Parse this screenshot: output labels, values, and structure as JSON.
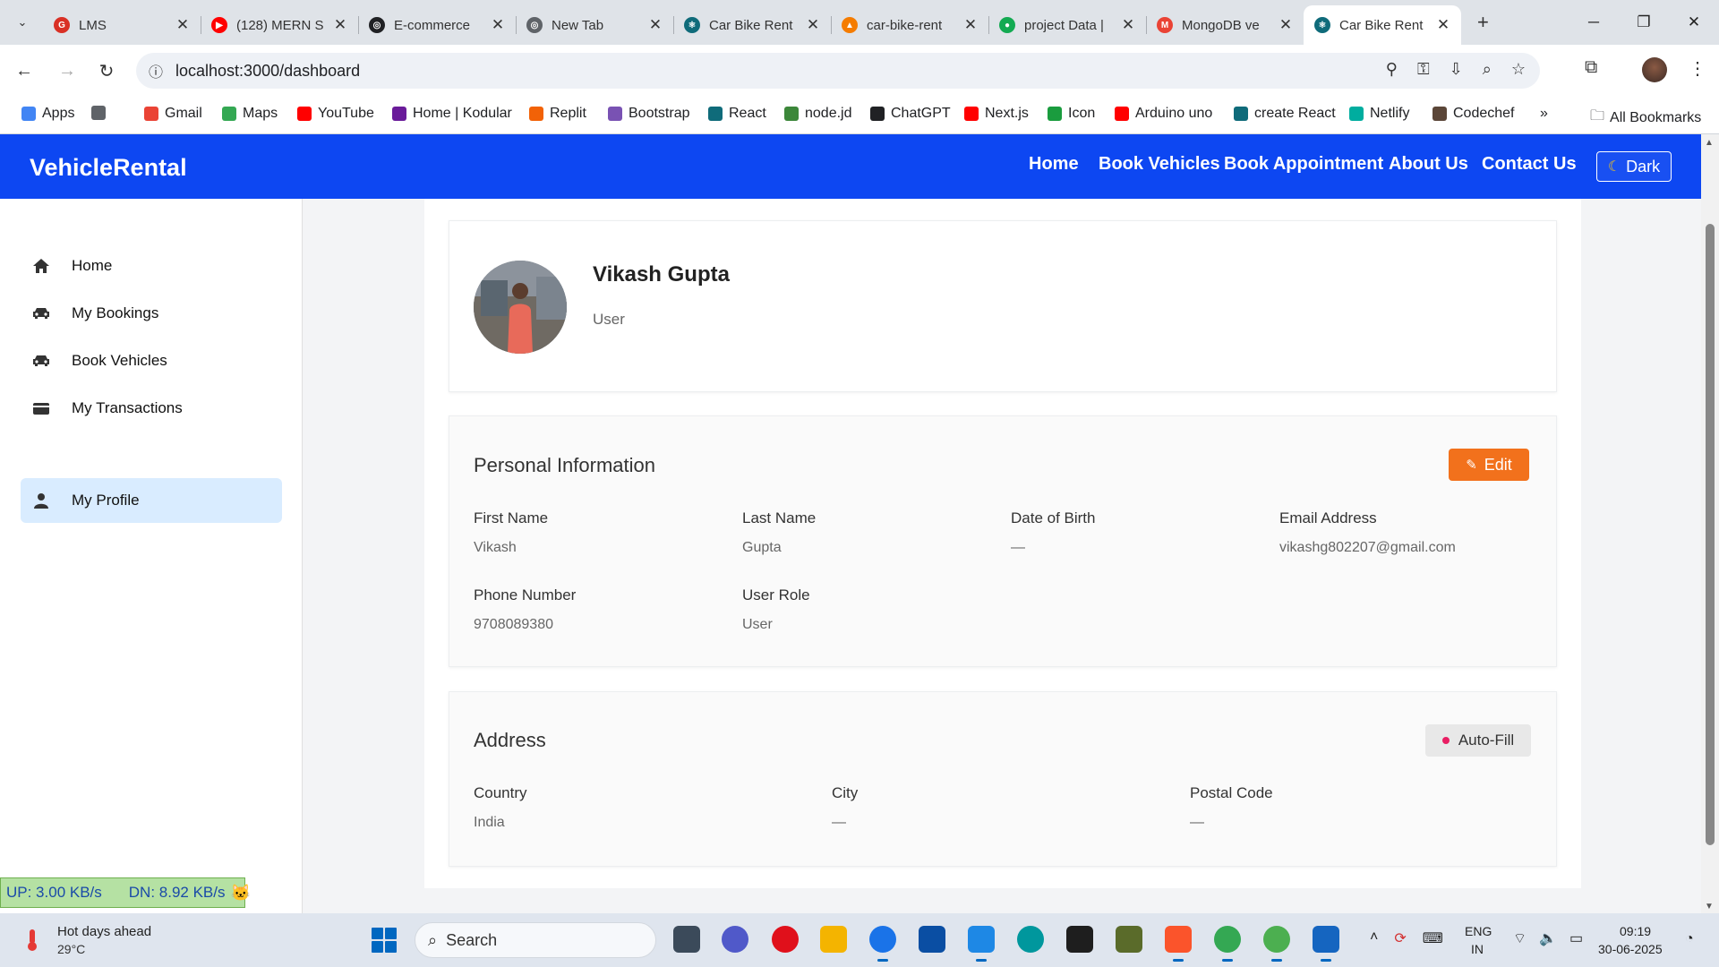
{
  "browser": {
    "tabs": [
      {
        "title": "LMS",
        "color": "#d93025",
        "glyph": "G"
      },
      {
        "title": "(128) MERN S",
        "color": "#ff0000",
        "glyph": "▶"
      },
      {
        "title": "E-commerce",
        "color": "#202124",
        "glyph": "◎"
      },
      {
        "title": "New Tab",
        "color": "#5f6368",
        "glyph": "◎"
      },
      {
        "title": "Car Bike Rent",
        "color": "#0f6b7a",
        "glyph": "⚛"
      },
      {
        "title": "car-bike-rent",
        "color": "#f57c00",
        "glyph": "▲"
      },
      {
        "title": "project Data |",
        "color": "#13aa52",
        "glyph": "●"
      },
      {
        "title": "MongoDB ve",
        "color": "#ea4335",
        "glyph": "M"
      },
      {
        "title": "Car Bike Rent",
        "color": "#0f6b7a",
        "glyph": "⚛"
      }
    ],
    "active_tab": 8,
    "url": "localhost:3000/dashboard",
    "bookmarks": [
      {
        "label": "Apps",
        "color": "#4285f4"
      },
      {
        "label": "",
        "color": "#5f6368"
      },
      {
        "label": "Gmail",
        "color": "#ea4335"
      },
      {
        "label": "Maps",
        "color": "#34a853"
      },
      {
        "label": "YouTube",
        "color": "#ff0000"
      },
      {
        "label": "Home | Kodular",
        "color": "#6a1b9a"
      },
      {
        "label": "Replit",
        "color": "#f26207"
      },
      {
        "label": "Bootstrap",
        "color": "#7952b3"
      },
      {
        "label": "React",
        "color": "#0f6b7a"
      },
      {
        "label": "node.jd",
        "color": "#3c873a"
      },
      {
        "label": "ChatGPT",
        "color": "#202124"
      },
      {
        "label": "Next.js",
        "color": "#ff0000"
      },
      {
        "label": "Icon",
        "color": "#1a9c3e"
      },
      {
        "label": "Arduino uno",
        "color": "#ff0000"
      },
      {
        "label": "create React",
        "color": "#0f6b7a"
      },
      {
        "label": "Netlify",
        "color": "#00ad9f"
      },
      {
        "label": "Codechef",
        "color": "#5b4638"
      }
    ],
    "bookmarks_more": "»",
    "all_bookmarks": "All Bookmarks"
  },
  "navbar": {
    "brand": "VehicleRental",
    "links": [
      "Home",
      "Book Vehicles",
      "Book Appointment",
      "About Us",
      "Contact Us"
    ],
    "dark_button": "Dark",
    "color": "#0d47f2"
  },
  "sidebar": {
    "items": [
      {
        "label": "Home",
        "icon": "home-icon"
      },
      {
        "label": "My Bookings",
        "icon": "car-icon"
      },
      {
        "label": "Book Vehicles",
        "icon": "car-icon"
      },
      {
        "label": "My Transactions",
        "icon": "wallet-icon"
      },
      {
        "label": "My Profile",
        "icon": "user-icon"
      }
    ],
    "active_index": 4
  },
  "profile": {
    "name": "Vikash Gupta",
    "role": "User"
  },
  "personal": {
    "title": "Personal Information",
    "edit_label": "Edit",
    "fields": [
      {
        "label": "First Name",
        "value": "Vikash"
      },
      {
        "label": "Last Name",
        "value": "Gupta"
      },
      {
        "label": "Date of Birth",
        "value": "—"
      },
      {
        "label": "Email Address",
        "value": "vikashg802207@gmail.com"
      },
      {
        "label": "Phone Number",
        "value": "9708089380"
      },
      {
        "label": "User Role",
        "value": "User"
      }
    ]
  },
  "address": {
    "title": "Address",
    "autofill_label": "Auto-Fill",
    "fields": [
      {
        "label": "Country",
        "value": "India"
      },
      {
        "label": "City",
        "value": "—"
      },
      {
        "label": "Postal Code",
        "value": "—"
      }
    ]
  },
  "net_widget": {
    "up": "UP: 3.00 KB/s",
    "down": "DN: 8.92 KB/s"
  },
  "taskbar": {
    "weather_title": "Hot days ahead",
    "weather_temp": "29°C",
    "search_label": "Search",
    "lang_1": "ENG",
    "lang_2": "IN",
    "time": "09:19",
    "date": "30-06-2025"
  },
  "colors": {
    "edit_button": "#f2711c",
    "active_sidebar": "#d9ecff",
    "net_widget_bg": "#b5e1a3"
  }
}
